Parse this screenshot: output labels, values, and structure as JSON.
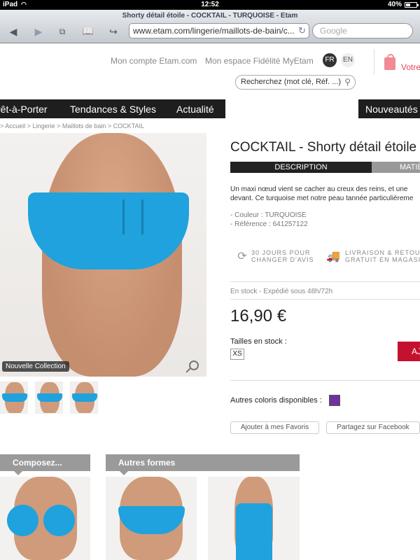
{
  "status_bar": {
    "carrier": "iPad",
    "time": "12:52",
    "battery": "40%",
    "battery_level": 0.4
  },
  "browser": {
    "page_title": "Shorty détail étoile - COCKTAIL - TURQUOISE - Etam",
    "url": "www.etam.com/lingerie/maillots-de-bain/c...",
    "search_placeholder": "Google"
  },
  "header": {
    "account_link": "Mon compte Etam.com",
    "loyalty_link": "Mon espace Fidélité MyEtam",
    "lang_fr": "FR",
    "lang_en": "EN",
    "cart_label": "Votre",
    "search_placeholder": "Recherchez (mot clé, Réf. ...)"
  },
  "nav": {
    "items": [
      "rêt-à-Porter",
      "Tendances & Styles",
      "Actualité",
      "Nouveautés"
    ]
  },
  "breadcrumb": [
    "> Accueil",
    "> Lingerie",
    "> Maillots de bain",
    "> COCKTAIL"
  ],
  "gallery": {
    "badge": "Nouvelle Collection"
  },
  "product": {
    "title": "COCKTAIL - Shorty détail étoile",
    "tabs": [
      "DESCRIPTION",
      "MATIÈ"
    ],
    "description_lines": [
      "Un maxi nœud vient se cacher au creux des reins, et une",
      "devant. Ce turquoise met notre peau tannée particulièreme"
    ],
    "color_line": "- Couleur : TURQUOISE",
    "ref_line": "- Référence : 641257122",
    "service_1": [
      "30 JOURS POUR",
      "CHANGER D'AVIS"
    ],
    "service_2": [
      "LIVRAISON & RETOUR",
      "GRATUIT EN MAGASIN"
    ],
    "stock_info": "En stock - Expédié sous 48h/72h",
    "price": "16,90 €",
    "sizes_label": "Tailles en stock :",
    "size": "XS",
    "add_button": "AJ",
    "other_colors_label": "Autres coloris disponibles :",
    "swatch_color": "#7032a0",
    "favorites_button": "Ajouter à mes Favoris",
    "facebook_button": "Partagez sur Facebook"
  },
  "sections": {
    "compose": "Composez...",
    "other_shapes": "Autres formes"
  },
  "colors": {
    "nav_bg": "#1e1e1e",
    "add_button": "#c4112f",
    "swimsuit": "#1fa2dd"
  }
}
